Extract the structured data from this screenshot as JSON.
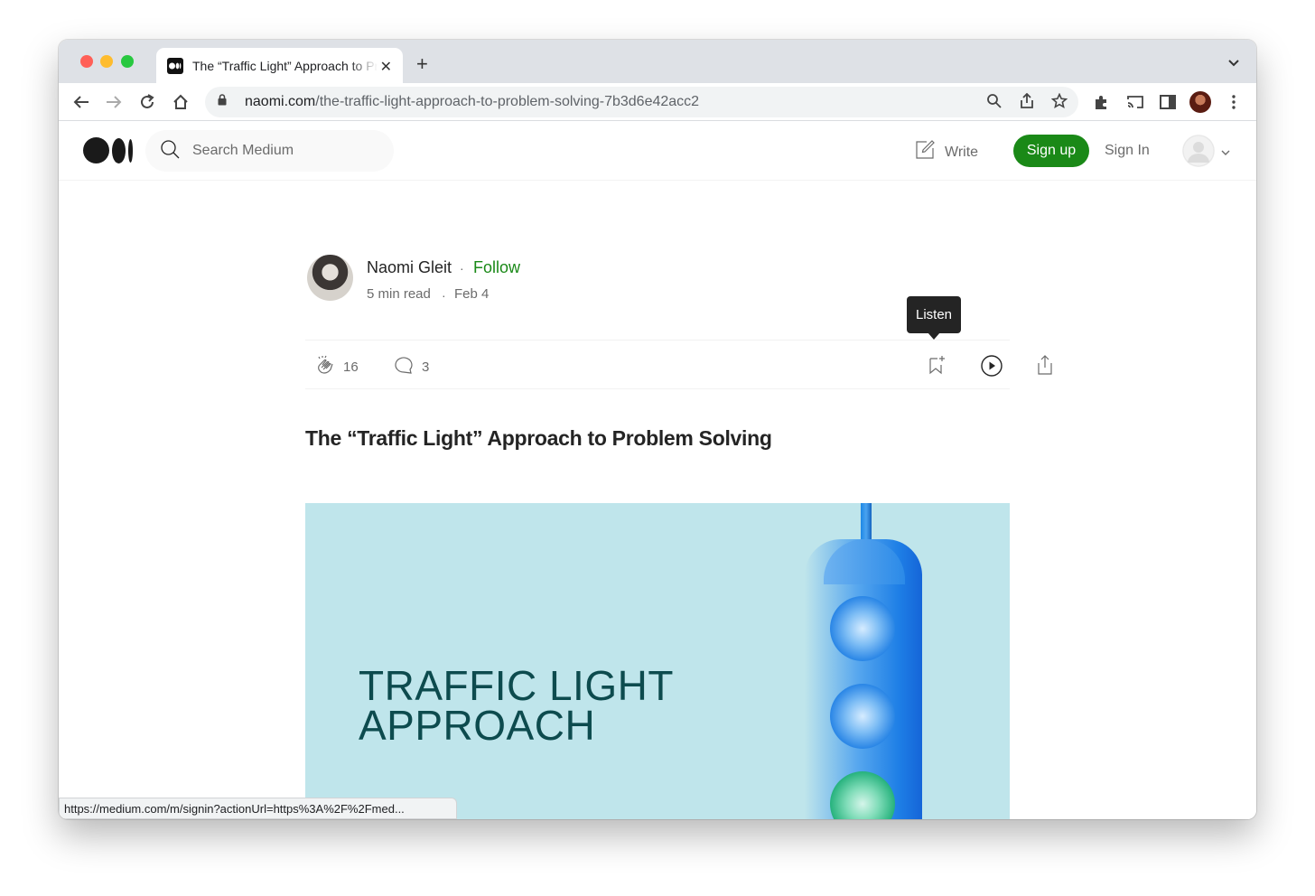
{
  "browser": {
    "tab_title": "The “Traffic Light” Approach to Problem Solving",
    "url_host": "naomi.com",
    "url_path": "/the-traffic-light-approach-to-problem-solving-7b3d6e42acc2",
    "status_url": "https://medium.com/m/signin?actionUrl=https%3A%2F%2Fmed..."
  },
  "header": {
    "search_placeholder": "Search Medium",
    "write_label": "Write",
    "signup_label": "Sign up",
    "signin_label": "Sign In"
  },
  "article": {
    "author": "Naomi Gleit",
    "follow_label": "Follow",
    "read_time": "5 min read",
    "date": "Feb 4",
    "claps": "16",
    "comments": "3",
    "listen_tooltip": "Listen",
    "title": "The “Traffic Light” Approach to Problem Solving",
    "hero_line1": "TRAFFIC LIGHT",
    "hero_line2": "APPROACH"
  },
  "colors": {
    "medium_green": "#1a8917",
    "hero_bg": "#bfe5eb",
    "hero_text": "#0d4b4e"
  }
}
